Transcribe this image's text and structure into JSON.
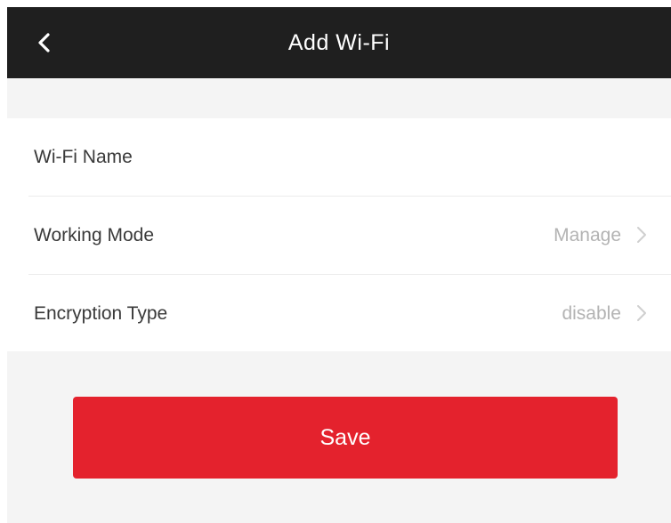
{
  "header": {
    "title": "Add Wi-Fi",
    "back_icon": "chevron-left-icon"
  },
  "form": {
    "rows": [
      {
        "label": "Wi-Fi Name",
        "value": ""
      },
      {
        "label": "Working Mode",
        "value": "Manage",
        "icon": "chevron-right-icon"
      },
      {
        "label": "Encryption Type",
        "value": "disable",
        "icon": "chevron-right-icon"
      }
    ]
  },
  "save_button": {
    "label": "Save"
  },
  "colors": {
    "header_bg": "#1f1f1f",
    "accent": "#e4222d",
    "page_bg": "#f4f4f4"
  }
}
